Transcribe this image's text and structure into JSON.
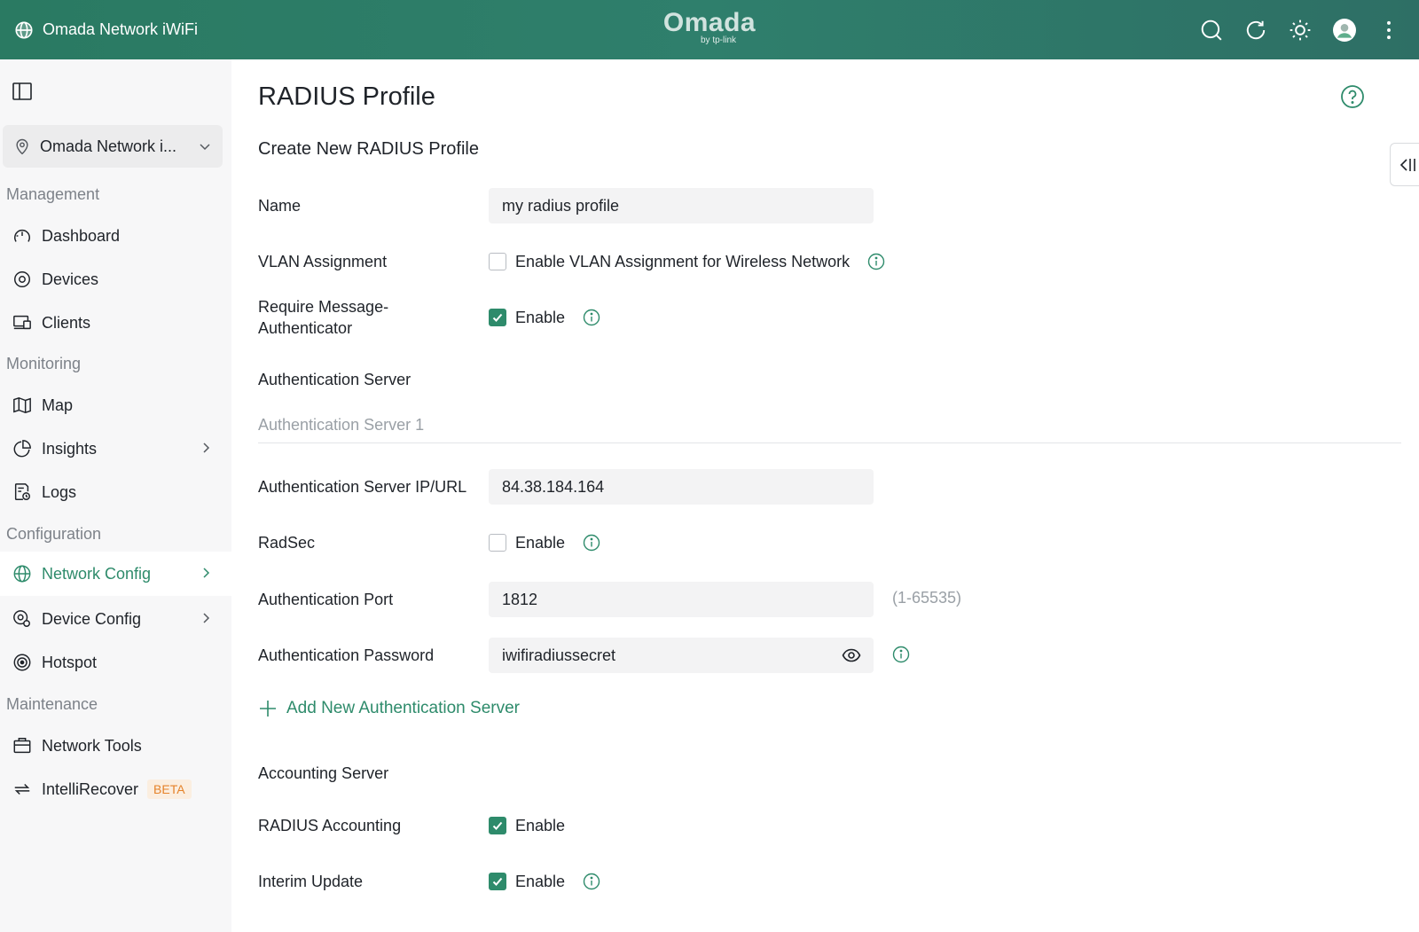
{
  "topbar": {
    "site_title": "Omada Network iWiFi",
    "logo_text": "Omada",
    "logo_sub": "by tp-link",
    "icons": [
      "search-icon",
      "refresh-icon",
      "theme-sun-icon",
      "avatar",
      "more-vertical-icon"
    ]
  },
  "sidebar": {
    "site_selector": "Omada Network i...",
    "sections": {
      "management": "Management",
      "monitoring": "Monitoring",
      "configuration": "Configuration",
      "maintenance": "Maintenance"
    },
    "items": {
      "dashboard": "Dashboard",
      "devices": "Devices",
      "clients": "Clients",
      "map": "Map",
      "insights": "Insights",
      "logs": "Logs",
      "network_config": "Network Config",
      "device_config": "Device Config",
      "hotspot": "Hotspot",
      "network_tools": "Network Tools",
      "intellirecover": "IntelliRecover"
    },
    "beta_badge": "BETA",
    "active_item": "Network Config"
  },
  "main": {
    "page_title": "RADIUS Profile",
    "sub_title": "Create New RADIUS Profile",
    "name": {
      "label": "Name",
      "value": "my radius profile"
    },
    "vlan": {
      "label": "VLAN Assignment",
      "checkbox_label": "Enable VLAN Assignment for Wireless Network",
      "checked": false
    },
    "msg_auth": {
      "label_line1": "Require Message-",
      "label_line2": "Authenticator",
      "checkbox_label": "Enable",
      "checked": true
    },
    "auth_server_title": "Authentication Server",
    "auth_server_caption": "Authentication Server 1",
    "auth_ip": {
      "label": "Authentication Server IP/URL",
      "value": "84.38.184.164"
    },
    "radsec": {
      "label": "RadSec",
      "checkbox_label": "Enable",
      "checked": false
    },
    "auth_port": {
      "label": "Authentication Port",
      "value": "1812",
      "hint": "(1-65535)"
    },
    "auth_password": {
      "label": "Authentication Password",
      "value": "iwifiradiussecret"
    },
    "add_server": "Add New Authentication Server",
    "acct_server_title": "Accounting Server",
    "radius_accounting": {
      "label": "RADIUS Accounting",
      "checkbox_label": "Enable",
      "checked": true
    },
    "interim_update": {
      "label": "Interim Update",
      "checkbox_label": "Enable",
      "checked": true
    }
  },
  "colors": {
    "accent": "#2e8b6b",
    "topbar": "#2f7f6c",
    "sidebar_bg": "#f7f7f8",
    "beta_text": "#e5832b"
  }
}
